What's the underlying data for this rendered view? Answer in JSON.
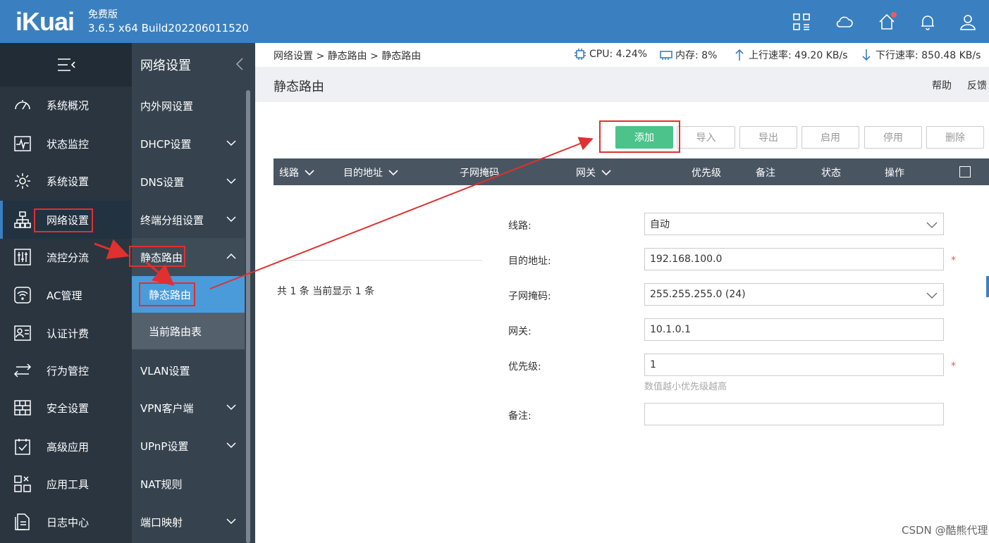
{
  "header": {
    "logo": "iKuai",
    "edition": "免费版",
    "version": "3.6.5 x64 Build202206011520",
    "icons": [
      "apps-icon",
      "cloud-icon",
      "home-icon",
      "bell-icon",
      "user-icon"
    ]
  },
  "nav1": {
    "items": [
      {
        "label": "系统概况",
        "icon": "dashboard-icon"
      },
      {
        "label": "状态监控",
        "icon": "monitor-icon"
      },
      {
        "label": "系统设置",
        "icon": "gear-icon"
      },
      {
        "label": "网络设置",
        "icon": "network-icon"
      },
      {
        "label": "流控分流",
        "icon": "sliders-icon"
      },
      {
        "label": "AC管理",
        "icon": "wifi-icon"
      },
      {
        "label": "认证计费",
        "icon": "id-card-icon"
      },
      {
        "label": "行为管控",
        "icon": "arrows-icon"
      },
      {
        "label": "安全设置",
        "icon": "firewall-icon"
      },
      {
        "label": "高级应用",
        "icon": "checklist-icon"
      },
      {
        "label": "应用工具",
        "icon": "tools-icon"
      },
      {
        "label": "日志中心",
        "icon": "log-icon"
      }
    ]
  },
  "nav2": {
    "title": "网络设置",
    "items": [
      {
        "label": "内外网设置"
      },
      {
        "label": "DHCP设置"
      },
      {
        "label": "DNS设置"
      },
      {
        "label": "终端分组设置"
      },
      {
        "label": "静态路由"
      },
      {
        "label": "VLAN设置"
      },
      {
        "label": "VPN客户端"
      },
      {
        "label": "UPnP设置"
      },
      {
        "label": "NAT规则"
      },
      {
        "label": "端口映射"
      }
    ],
    "sub": [
      {
        "label": "静态路由"
      },
      {
        "label": "当前路由表"
      }
    ]
  },
  "statusbar": {
    "breadcrumb": "网络设置 > 静态路由 > 静态路由",
    "cpu": "CPU: 4.24%",
    "memory": "内存: 8%",
    "upload": "上行速率: 49.20 KB/s",
    "download": "下行速率: 850.48 KB/s"
  },
  "page": {
    "title": "静态路由",
    "help": "帮助",
    "feedback": "反馈"
  },
  "toolbar": {
    "add": "添加",
    "import": "导入",
    "export": "导出",
    "enable": "启用",
    "disable": "停用",
    "delete": "删除"
  },
  "table": {
    "columns": [
      "线路",
      "目的地址",
      "子网掩码",
      "网关",
      "优先级",
      "备注",
      "状态",
      "操作"
    ],
    "count": "共 1 条 当前显示 1 条"
  },
  "form": {
    "line_label": "线路:",
    "line_value": "自动",
    "dest_label": "目的地址:",
    "dest_value": "192.168.100.0",
    "mask_label": "子网掩码:",
    "mask_value": "255.255.255.0 (24)",
    "gateway_label": "网关:",
    "gateway_value": "10.1.0.1",
    "priority_label": "优先级:",
    "priority_value": "1",
    "priority_hint": "数值越小优先级越高",
    "remark_label": "备注:",
    "remark_value": "",
    "required_mark": "*"
  },
  "watermark": "CSDN @酷熊代理",
  "colors": {
    "header": "#3a80c0",
    "sidebar": "#2a3540",
    "submenu": "#36434f",
    "selected": "#4a9bda",
    "primary_button": "#4cc38a",
    "annotation": "#e03030"
  }
}
